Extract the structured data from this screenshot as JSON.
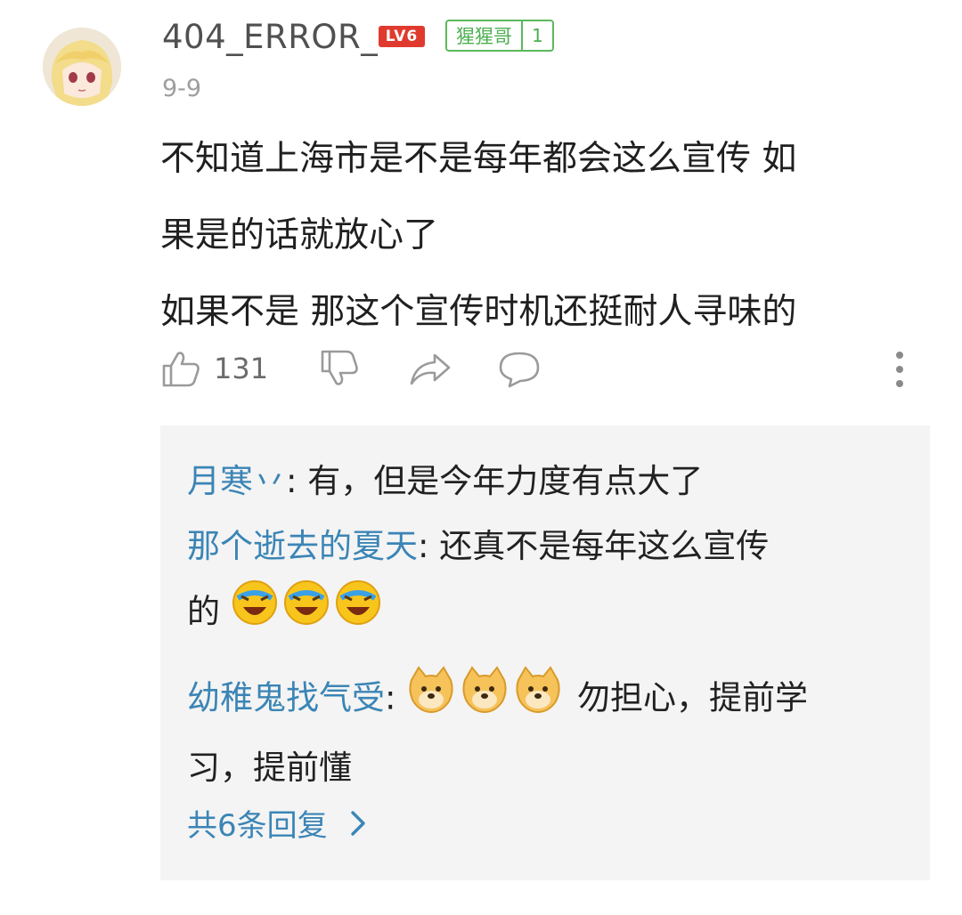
{
  "comment": {
    "username": "404_ERROR_",
    "level_badge": "LV6",
    "fan_badge": {
      "name": "猩猩哥",
      "level": "1"
    },
    "date": "9-9",
    "text_lines": [
      "不知道上海市是不是每年都会这么宣传 如",
      "果是的话就放心了",
      "如果不是 那这个宣传时机还挺耐人寻味的"
    ],
    "like_count": "131"
  },
  "icons": {
    "like": "thumbs-up-icon",
    "dislike": "thumbs-down-icon",
    "share": "share-icon",
    "reply": "comment-bubble-icon",
    "more": "more-vertical-icon"
  },
  "replies": [
    {
      "nick": "月寒丷",
      "text": ": 有，但是今年力度有点大了"
    },
    {
      "nick": "那个逝去的夏天",
      "text": ": 还真不是每年这么宣传",
      "text2": "的",
      "emoji": "laughing-crying-emoji",
      "emoji_count": 3
    },
    {
      "nick": "幼稚鬼找气受",
      "text_prefix": ": ",
      "emoji": "doge-emoji",
      "emoji_count": 3,
      "text": " 勿担心，提前学",
      "text2": "习，提前懂"
    }
  ],
  "more_replies_label": "共6条回复",
  "colors": {
    "link_blue": "#3b85b6",
    "badge_red": "#e03a2e",
    "badge_green": "#4caf50",
    "reply_bg": "#f4f4f4"
  }
}
